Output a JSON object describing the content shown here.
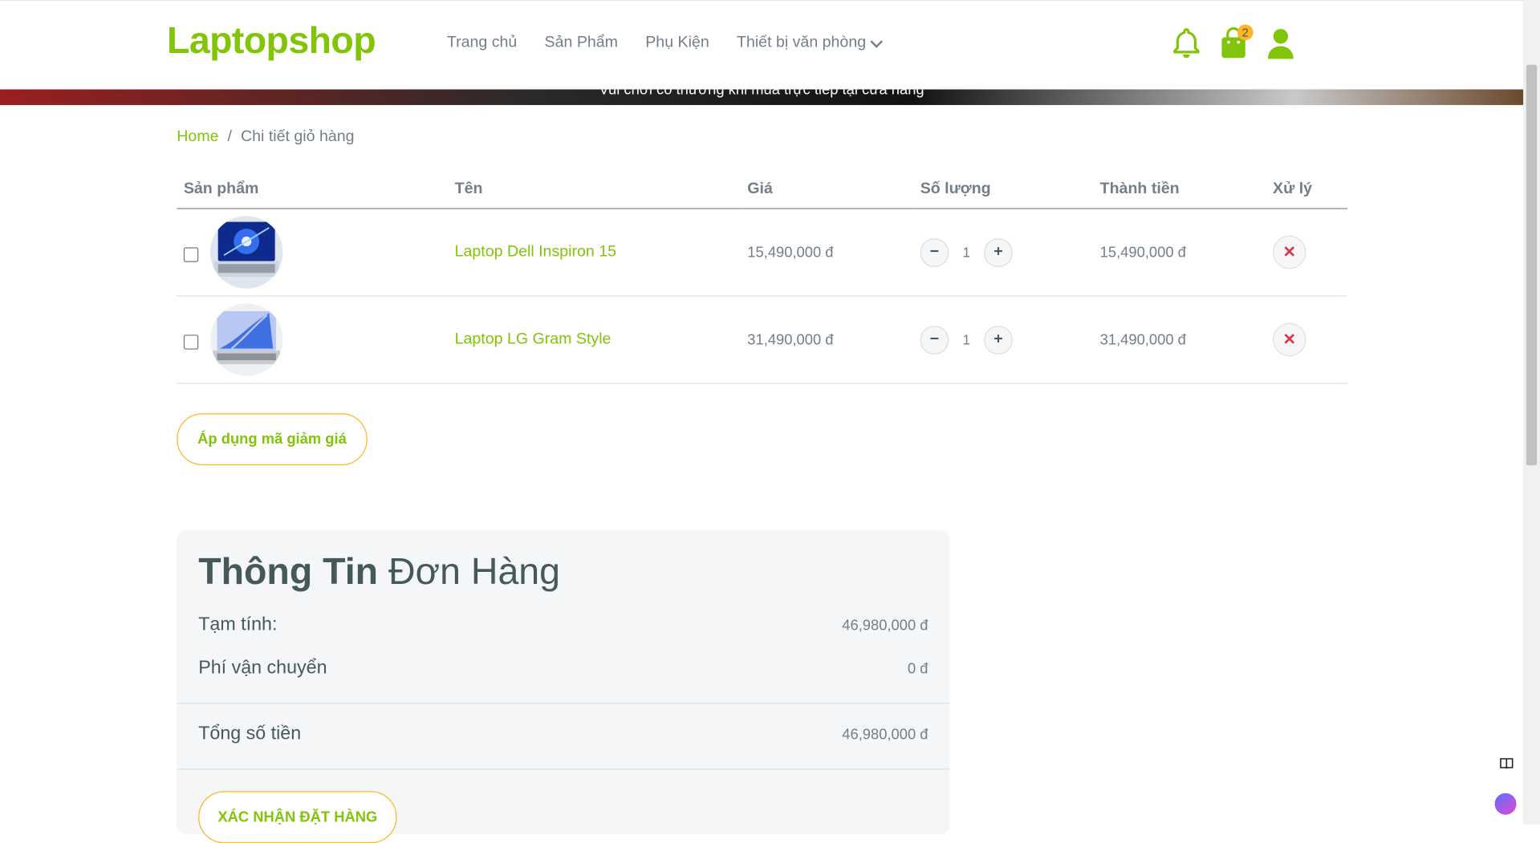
{
  "brand": "Laptopshop",
  "nav": {
    "home": "Trang chủ",
    "products": "Sản Phẩm",
    "accessories": "Phụ Kiện",
    "office": "Thiết bị văn phòng"
  },
  "cart_count": "2",
  "banner_text": "Vui chơi có thưởng khi mua trực tiếp tại cửa hàng",
  "breadcrumb": {
    "home": "Home",
    "sep": "/",
    "current": "Chi tiết giỏ hàng"
  },
  "table": {
    "headers": [
      "Sản phẩm",
      "Tên",
      "Giá",
      "Số lượng",
      "Thành tiền",
      "Xử lý"
    ],
    "rows": [
      {
        "name": "Laptop Dell Inspiron 15",
        "price": "15,490,000 đ",
        "qty": "1",
        "total": "15,490,000 đ"
      },
      {
        "name": "Laptop LG Gram Style",
        "price": "31,490,000 đ",
        "qty": "1",
        "total": "31,490,000 đ"
      }
    ]
  },
  "coupon_label": "Áp dụng mã giảm giá",
  "summary": {
    "title_bold": "Thông Tin",
    "title_rest": "Đơn Hàng",
    "subtotal_label": "Tạm tính:",
    "subtotal_value": "46,980,000 đ",
    "shipping_label": "Phí vận chuyển",
    "shipping_value": "0 đ",
    "total_label": "Tổng số tiền",
    "total_value": "46,980,000 đ",
    "confirm_label": "XÁC NHẬN ĐẶT HÀNG"
  },
  "colors": {
    "accent": "#81c408",
    "secondary": "#ffb524",
    "text": "#45595b",
    "muted": "#747d88",
    "danger": "#dc3545"
  },
  "icons": [
    "bell-icon",
    "shopping-bag-icon",
    "user-icon",
    "minus-icon",
    "plus-icon",
    "close-icon",
    "chevron-down-icon",
    "book-icon",
    "brain-icon"
  ]
}
